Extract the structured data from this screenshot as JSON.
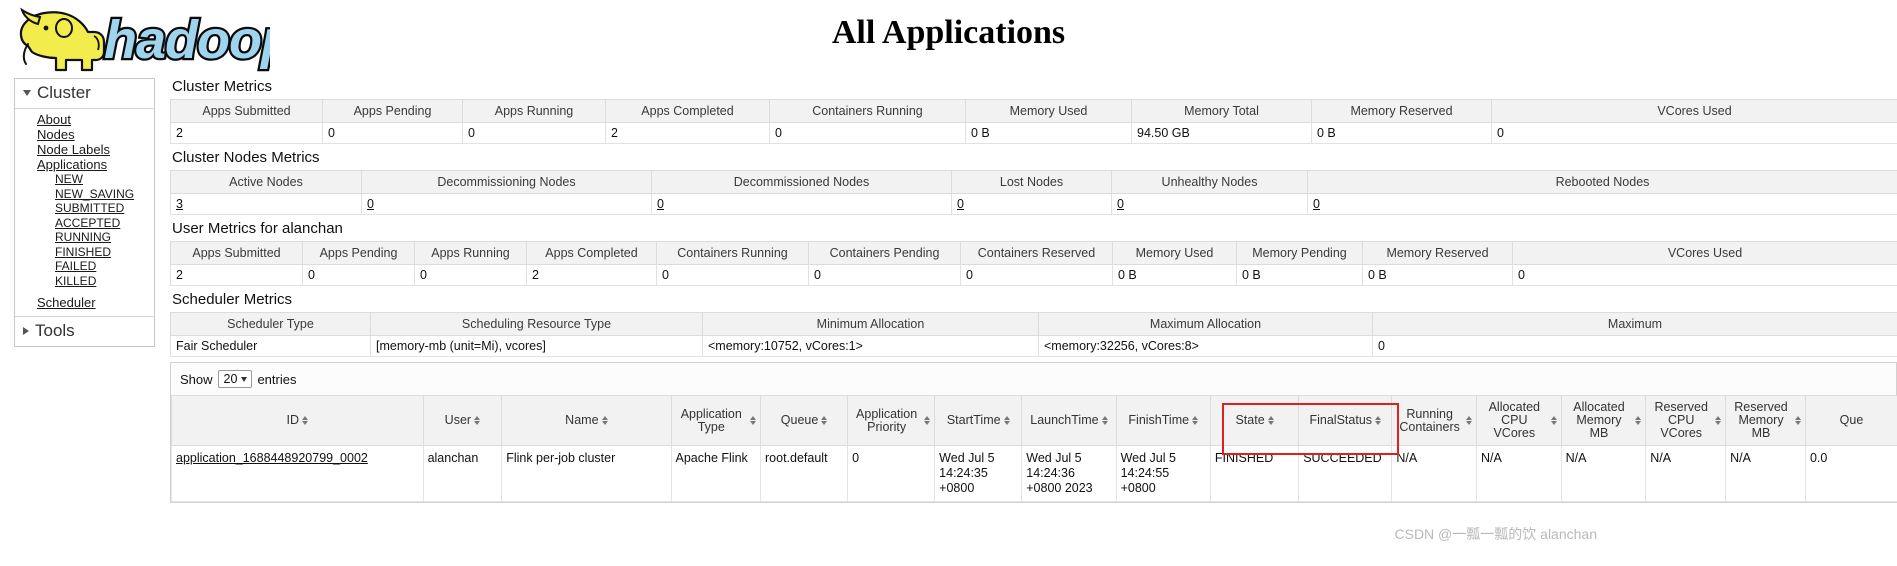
{
  "header": {
    "logo_text": "hadoop",
    "title": "All Applications"
  },
  "sidebar": {
    "cluster": {
      "label": "Cluster",
      "items": [
        {
          "label": "About"
        },
        {
          "label": "Nodes"
        },
        {
          "label": "Node Labels"
        },
        {
          "label": "Applications"
        }
      ],
      "app_states": [
        {
          "label": "NEW"
        },
        {
          "label": "NEW_SAVING"
        },
        {
          "label": "SUBMITTED"
        },
        {
          "label": "ACCEPTED"
        },
        {
          "label": "RUNNING"
        },
        {
          "label": "FINISHED"
        },
        {
          "label": "FAILED"
        },
        {
          "label": "KILLED"
        }
      ],
      "scheduler": {
        "label": "Scheduler"
      }
    },
    "tools": {
      "label": "Tools"
    }
  },
  "cluster_metrics": {
    "title": "Cluster Metrics",
    "headers": [
      "Apps Submitted",
      "Apps Pending",
      "Apps Running",
      "Apps Completed",
      "Containers Running",
      "Memory Used",
      "Memory Total",
      "Memory Reserved",
      "VCores Used"
    ],
    "values": [
      "2",
      "0",
      "0",
      "2",
      "0",
      "0 B",
      "94.50 GB",
      "0 B",
      "0"
    ]
  },
  "cluster_nodes_metrics": {
    "title": "Cluster Nodes Metrics",
    "headers": [
      "Active Nodes",
      "Decommissioning Nodes",
      "Decommissioned Nodes",
      "Lost Nodes",
      "Unhealthy Nodes",
      "Rebooted Nodes"
    ],
    "values": [
      "3",
      "0",
      "0",
      "0",
      "0",
      "0"
    ]
  },
  "user_metrics": {
    "title": "User Metrics for alanchan",
    "headers": [
      "Apps Submitted",
      "Apps Pending",
      "Apps Running",
      "Apps Completed",
      "Containers Running",
      "Containers Pending",
      "Containers Reserved",
      "Memory Used",
      "Memory Pending",
      "Memory Reserved",
      "VCores Used"
    ],
    "values": [
      "2",
      "0",
      "0",
      "2",
      "0",
      "0",
      "0",
      "0 B",
      "0 B",
      "0 B",
      "0"
    ]
  },
  "scheduler_metrics": {
    "title": "Scheduler Metrics",
    "headers": [
      "Scheduler Type",
      "Scheduling Resource Type",
      "Minimum Allocation",
      "Maximum Allocation",
      "Maximum"
    ],
    "values": [
      "Fair Scheduler",
      "[memory-mb (unit=Mi), vcores]",
      "<memory:10752, vCores:1>",
      "<memory:32256, vCores:8>",
      "0"
    ]
  },
  "apps_table": {
    "show_label": "Show",
    "entries_value": "20",
    "entries_label": "entries",
    "headers": [
      "ID",
      "User",
      "Name",
      "Application Type",
      "Queue",
      "Application Priority",
      "StartTime",
      "LaunchTime",
      "FinishTime",
      "State",
      "FinalStatus",
      "Running Containers",
      "Allocated CPU VCores",
      "Allocated Memory MB",
      "Reserved CPU VCores",
      "Reserved Memory MB",
      "Que"
    ],
    "rows": [
      {
        "id": "application_1688448920799_0002",
        "user": "alanchan",
        "name": "Flink per-job cluster",
        "application_type": "Apache Flink",
        "queue": "root.default",
        "application_priority": "0",
        "start_time": "Wed Jul 5 14:24:35 +0800",
        "launch_time": "Wed Jul 5 14:24:36 +0800 2023",
        "finish_time": "Wed Jul 5 14:24:55 +0800",
        "state": "FINISHED",
        "final_status": "SUCCEEDED",
        "running_containers": "N/A",
        "allocated_cpu_vcores": "N/A",
        "allocated_memory_mb": "N/A",
        "reserved_cpu_vcores": "N/A",
        "reserved_memory_mb": "N/A",
        "queue_extra": "0.0"
      }
    ]
  },
  "watermark": "CSDN @一瓢一瓢的饮 alanchan",
  "colors": {
    "highlight_border": "#e02020",
    "header_bg": "#f2f2f2",
    "logo_blue": "#9fd4ef",
    "logo_yellow": "#f2ec4c"
  }
}
